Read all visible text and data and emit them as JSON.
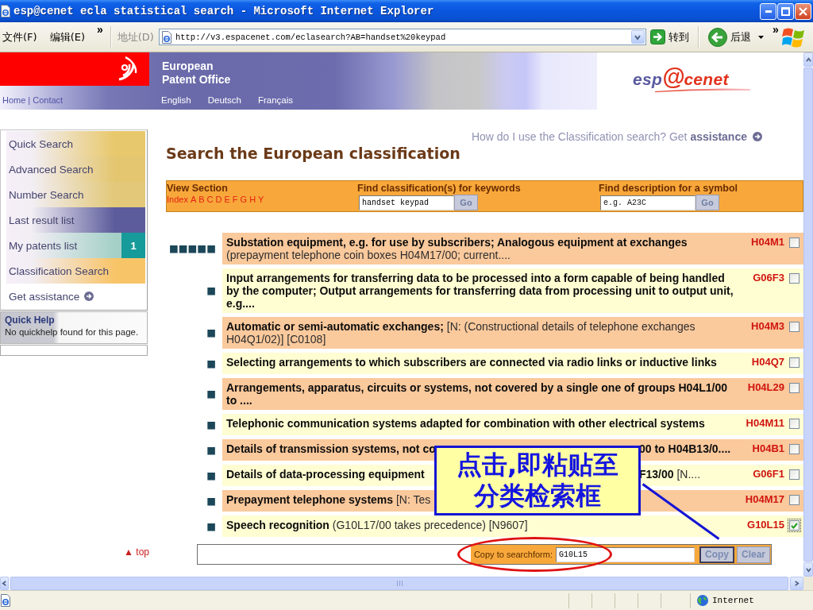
{
  "window": {
    "title": "esp@cenet ecla statistical search - Microsoft Internet Explorer"
  },
  "toolbar": {
    "menus": [
      "文件(F)",
      "编辑(E)"
    ],
    "menu_overflow": "»",
    "address_label": "地址(D)",
    "url": "http://v3.espacenet.com/eclasearch?AB=handset%20keypad",
    "go_label": "转到",
    "back_label": "后退",
    "toolbar_overflow": "»"
  },
  "header": {
    "org_name": "European\nPatent Office",
    "top_links": [
      "Home",
      "Contact"
    ],
    "top_links_separator": "|",
    "languages": [
      "English",
      "Deutsch",
      "Français"
    ],
    "logo": [
      "esp",
      "@",
      "cenet"
    ]
  },
  "sidebar": {
    "items": [
      {
        "label": "Quick Search",
        "kind": "nav",
        "color": "#e8c86c"
      },
      {
        "label": "Advanced Search",
        "kind": "nav",
        "color": "#e4c670"
      },
      {
        "label": "Number Search",
        "kind": "nav",
        "color": "#e2c878"
      },
      {
        "label": "Last result list",
        "kind": "nav",
        "color": "#5c5c9c"
      },
      {
        "label": "My patents list",
        "kind": "nav",
        "color": "#a4d0c8",
        "badge": "1"
      },
      {
        "label": "Classification Search",
        "kind": "nav",
        "color": "#f8c468"
      },
      {
        "label": "Get assistance",
        "kind": "help"
      }
    ],
    "quick_help": {
      "title": "Quick Help",
      "text": "No quickhelp found for this page."
    }
  },
  "main": {
    "help_prompt": "How do I use the Classification search? Get",
    "help_link": "assistance",
    "title": "Search the European classification",
    "search_bar": {
      "view_section": {
        "label": "View Section",
        "links": [
          "Index",
          "A",
          "B",
          "C",
          "D",
          "E",
          "F",
          "G",
          "H",
          "Y"
        ]
      },
      "keyword_search": {
        "label": "Find classification(s) for keywords",
        "value": "handset keypad",
        "button": "Go"
      },
      "symbol_search": {
        "label": "Find description for a symbol",
        "placeholder": "e.g. A23C",
        "button": "Go"
      }
    },
    "results": [
      {
        "marker": "■■■■■",
        "parts": [
          {
            "text": "**Substation equipment, e.g. for use by subscribers; Analogous equipment at exchanges** (prepayment telephone coin boxes H04M17/00; current....",
            "bold": false
          }
        ],
        "code": "H04M1",
        "checked": false
      },
      {
        "marker": "■",
        "parts": [
          {
            "text": "Input arrangements for transferring data to be processed into a form capable of being handled by the computer; Output arrangements for transferring data from processing unit to output unit, e.g....",
            "bold": true
          }
        ],
        "code": "G06F3",
        "checked": false
      },
      {
        "marker": "■",
        "parts": [
          {
            "text": "**Automatic or semi-automatic exchanges;** [N: (Constructional details of telephone exchanges H04Q1/02)] [C0108]",
            "bold": false
          }
        ],
        "code": "H04M3",
        "checked": false
      },
      {
        "marker": "■",
        "parts": [
          {
            "text": "Selecting arrangements to which subscribers are connected via radio links or inductive links",
            "bold": true
          }
        ],
        "code": "H04Q7",
        "checked": false
      },
      {
        "marker": "■",
        "parts": [
          {
            "text": "Arrangements, apparatus, circuits or systems, not covered by a single one of groups H04L1/00 to ....",
            "bold": true
          }
        ],
        "code": "H04L29",
        "checked": false
      },
      {
        "marker": "■",
        "parts": [
          {
            "text": "Telephonic communication systems adapted for combination with other electrical systems",
            "bold": true
          }
        ],
        "code": "H04M11",
        "checked": false
      },
      {
        "marker": "■",
        "parts": [
          {
            "text": "Details of transmission systems, not co",
            "bold": true
          },
          {
            "text": "00 to H04B13/0....",
            "bold": true
          }
        ],
        "code": "H04B1",
        "checked": false
      },
      {
        "marker": "■",
        "parts": [
          {
            "text": "Details of data-processing equipment",
            "bold": true
          },
          {
            "text": "**F13/00** [N....",
            "bold": false
          }
        ],
        "code": "G06F1",
        "checked": false
      },
      {
        "marker": "■",
        "parts": [
          {
            "text": "**Prepayment telephone systems** [N: Tes",
            "bold": false
          }
        ],
        "code": "H04M17",
        "checked": false
      },
      {
        "marker": "■",
        "parts": [
          {
            "text": "**Speech recognition** (G10L17/00 takes precedence) [N9607]",
            "bold": false
          }
        ],
        "code": "G10L15",
        "checked": true
      }
    ],
    "callout": {
      "text": "点击,即粘贴至分类检索框"
    },
    "copy_bar": {
      "top_link": "▲ top",
      "label": "Copy to searchform:",
      "value": "G10L15",
      "buttons": [
        {
          "label": "Copy",
          "focused": true
        },
        {
          "label": "Clear",
          "focused": false
        }
      ]
    }
  },
  "status_bar": {
    "zone": "Internet"
  }
}
